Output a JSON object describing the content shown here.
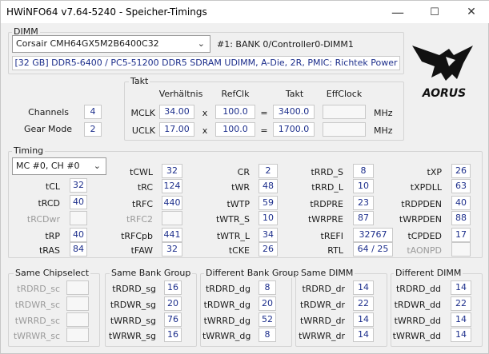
{
  "title": "HWiNFO64 v7.64-5240 - Speicher-Timings",
  "window_buttons": {
    "minimize": "—",
    "maximize": "☐",
    "close": "✕"
  },
  "dimm": {
    "group_label": "DIMM",
    "module_select": "Corsair CMH64GX5M2B6400C32",
    "slot_label": "#1: BANK 0/Controller0-DIMM1",
    "info": "[32 GB] DDR5-6400 / PC5-51200 DDR5 SDRAM UDIMM, A-Die, 2R, PMIC: Richtek Power"
  },
  "brand_logo_text": "AORUS",
  "overview": {
    "channels_label": "Channels",
    "channels_value": "4",
    "gearmode_label": "Gear Mode",
    "gearmode_value": "2"
  },
  "takt": {
    "group_label": "Takt",
    "headers": {
      "ratio": "Verhältnis",
      "refclk": "RefClk",
      "clock": "Takt",
      "effclock": "EffClock"
    },
    "mclk": {
      "label": "MCLK",
      "ratio": "34.00",
      "times": "x",
      "refclk": "100.0",
      "equals": "=",
      "clock": "3400.0",
      "effclock": "",
      "unit": "MHz"
    },
    "uclk": {
      "label": "UCLK",
      "ratio": "17.00",
      "times": "x",
      "refclk": "100.0",
      "equals": "=",
      "clock": "1700.0",
      "effclock": "",
      "unit": "MHz"
    }
  },
  "timing": {
    "group_label": "Timing",
    "channel_select": "MC #0, CH #0",
    "col1": [
      {
        "label": "tCL",
        "value": "32"
      },
      {
        "label": "tRCD",
        "value": "40"
      },
      {
        "label": "tRCDwr",
        "value": ""
      },
      {
        "label": "tRP",
        "value": "40"
      },
      {
        "label": "tRAS",
        "value": "84"
      }
    ],
    "col2": [
      {
        "label": "tCWL",
        "value": "32"
      },
      {
        "label": "tRC",
        "value": "124"
      },
      {
        "label": "tRFC",
        "value": "440"
      },
      {
        "label": "tRFC2",
        "value": ""
      },
      {
        "label": "tRFCpb",
        "value": "441"
      },
      {
        "label": "tFAW",
        "value": "32"
      }
    ],
    "col3": [
      {
        "label": "CR",
        "value": "2"
      },
      {
        "label": "tWR",
        "value": "48"
      },
      {
        "label": "tWTP",
        "value": "59"
      },
      {
        "label": "tWTR_S",
        "value": "10"
      },
      {
        "label": "tWTR_L",
        "value": "34"
      },
      {
        "label": "tCKE",
        "value": "26"
      }
    ],
    "col4": [
      {
        "label": "tRRD_S",
        "value": "8"
      },
      {
        "label": "tRRD_L",
        "value": "10"
      },
      {
        "label": "tRDPRE",
        "value": "23"
      },
      {
        "label": "tWRPRE",
        "value": "87"
      },
      {
        "label": "tREFI",
        "value": "32767"
      },
      {
        "label": "RTL",
        "value": "64 / 25"
      }
    ],
    "col5": [
      {
        "label": "tXP",
        "value": "26"
      },
      {
        "label": "tXPDLL",
        "value": "63"
      },
      {
        "label": "tRDPDEN",
        "value": "40"
      },
      {
        "label": "tWRPDEN",
        "value": "88"
      },
      {
        "label": "tCPDED",
        "value": "17"
      },
      {
        "label": "tAONPD",
        "value": ""
      }
    ]
  },
  "groups": {
    "same_chipselect": {
      "label": "Same Chipselect",
      "rows": [
        {
          "label": "tRDRD_sc",
          "value": ""
        },
        {
          "label": "tRDWR_sc",
          "value": ""
        },
        {
          "label": "tWRRD_sc",
          "value": ""
        },
        {
          "label": "tWRWR_sc",
          "value": ""
        }
      ]
    },
    "same_bank_group": {
      "label": "Same Bank Group",
      "rows": [
        {
          "label": "tRDRD_sg",
          "value": "16"
        },
        {
          "label": "tRDWR_sg",
          "value": "20"
        },
        {
          "label": "tWRRD_sg",
          "value": "76"
        },
        {
          "label": "tWRWR_sg",
          "value": "16"
        }
      ]
    },
    "diff_bank_group": {
      "label": "Different Bank Group",
      "rows": [
        {
          "label": "tRDRD_dg",
          "value": "8"
        },
        {
          "label": "tRDWR_dg",
          "value": "20"
        },
        {
          "label": "tWRRD_dg",
          "value": "52"
        },
        {
          "label": "tWRWR_dg",
          "value": "8"
        }
      ]
    },
    "same_dimm": {
      "label": "Same DIMM",
      "rows": [
        {
          "label": "tRDRD_dr",
          "value": "14"
        },
        {
          "label": "tRDWR_dr",
          "value": "22"
        },
        {
          "label": "tWRRD_dr",
          "value": "14"
        },
        {
          "label": "tWRWR_dr",
          "value": "14"
        }
      ]
    },
    "diff_dimm": {
      "label": "Different DIMM",
      "rows": [
        {
          "label": "tRDRD_dd",
          "value": "14"
        },
        {
          "label": "tRDWR_dd",
          "value": "22"
        },
        {
          "label": "tWRRD_dd",
          "value": "14"
        },
        {
          "label": "tWRWR_dd",
          "value": "14"
        }
      ]
    }
  }
}
